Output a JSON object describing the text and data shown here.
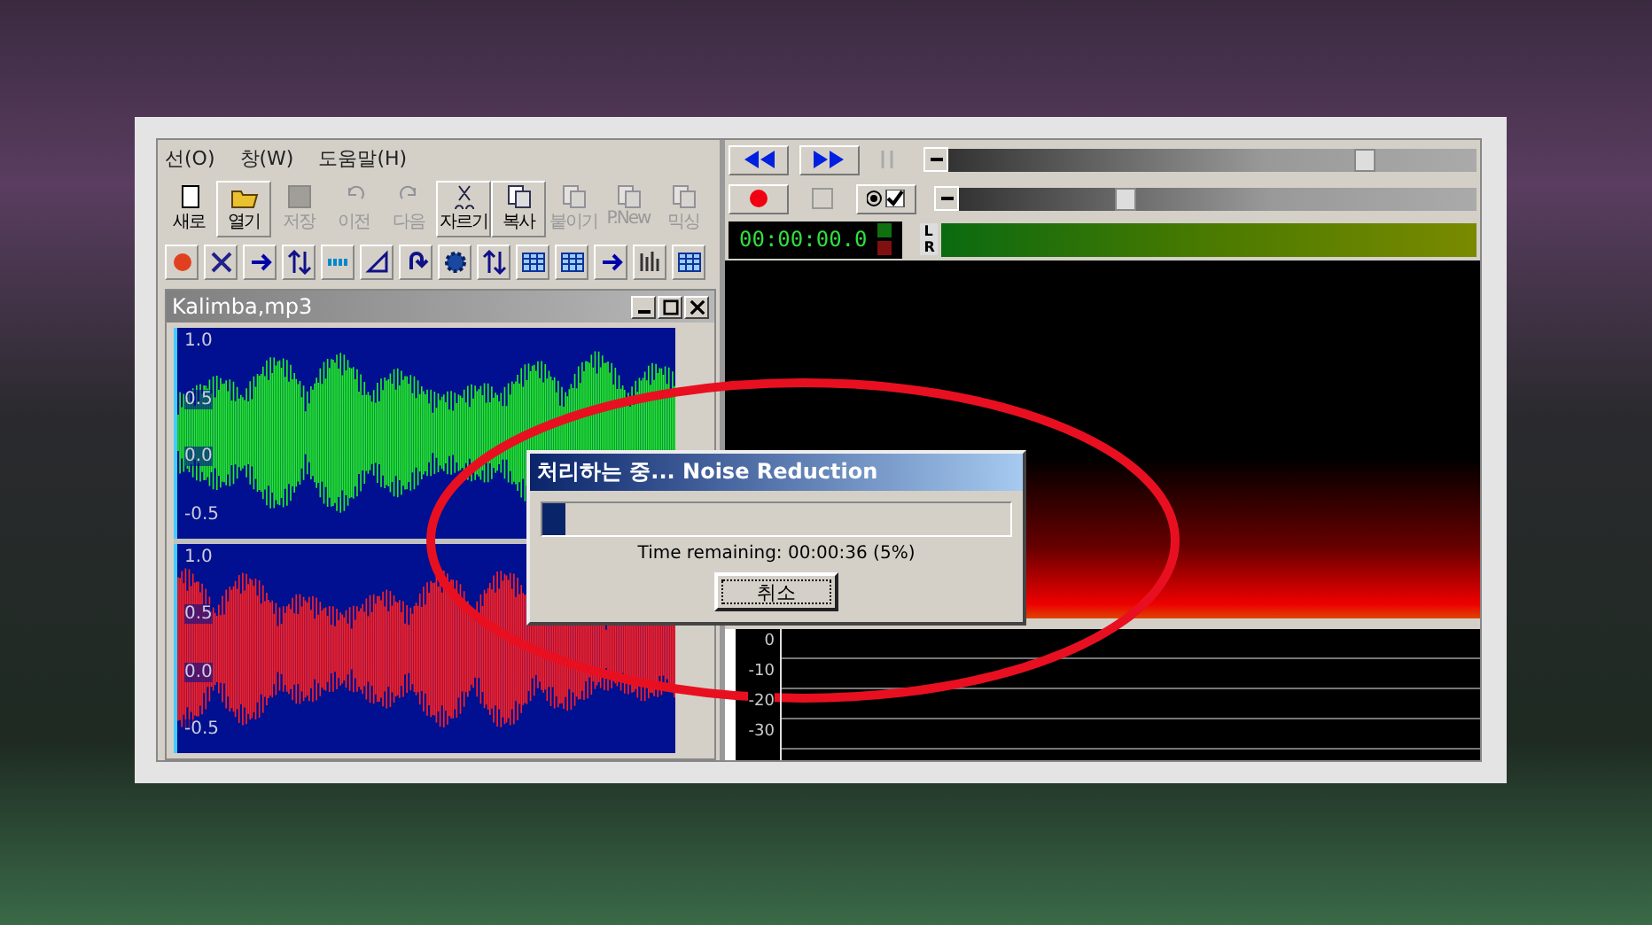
{
  "menu": [
    {
      "label": "선(O)"
    },
    {
      "label": "창(W)"
    },
    {
      "label": "도움말(H)"
    }
  ],
  "toolbar": [
    {
      "label": "새로",
      "disabled": false
    },
    {
      "label": "열기",
      "disabled": false
    },
    {
      "label": "저장",
      "disabled": true
    },
    {
      "label": "이전",
      "disabled": true
    },
    {
      "label": "다음",
      "disabled": true
    },
    {
      "label": "자르기",
      "disabled": false
    },
    {
      "label": "복사",
      "disabled": false
    },
    {
      "label": "붙이기",
      "disabled": true
    },
    {
      "label": "P.New",
      "disabled": true
    },
    {
      "label": "믹싱",
      "disabled": true
    }
  ],
  "document": {
    "title": "Kalimba,mp3",
    "channels": [
      {
        "color": "#22ee22",
        "axis_labels": [
          "1.0",
          "0.5",
          "0.0",
          "-0.5"
        ]
      },
      {
        "color": "#ff2020",
        "axis_labels": [
          "1.0",
          "0.5",
          "0.0",
          "-0.5"
        ]
      }
    ]
  },
  "transport": {
    "sliders": [
      {
        "level": 0.77
      },
      {
        "level": 0.3
      }
    ],
    "loop_checkbox": {
      "checked": false
    },
    "time": "00:00:00.0",
    "meter_labels": [
      "L",
      "R"
    ]
  },
  "spectrum": {
    "db_labels": [
      "0",
      "-10",
      "-20",
      "-30"
    ]
  },
  "dialog": {
    "title": "처리하는 중... Noise Reduction",
    "progress": {
      "level": 0.05
    },
    "status": "Time remaining: 00:00:36 (5%)",
    "cancel_button": "취소"
  }
}
